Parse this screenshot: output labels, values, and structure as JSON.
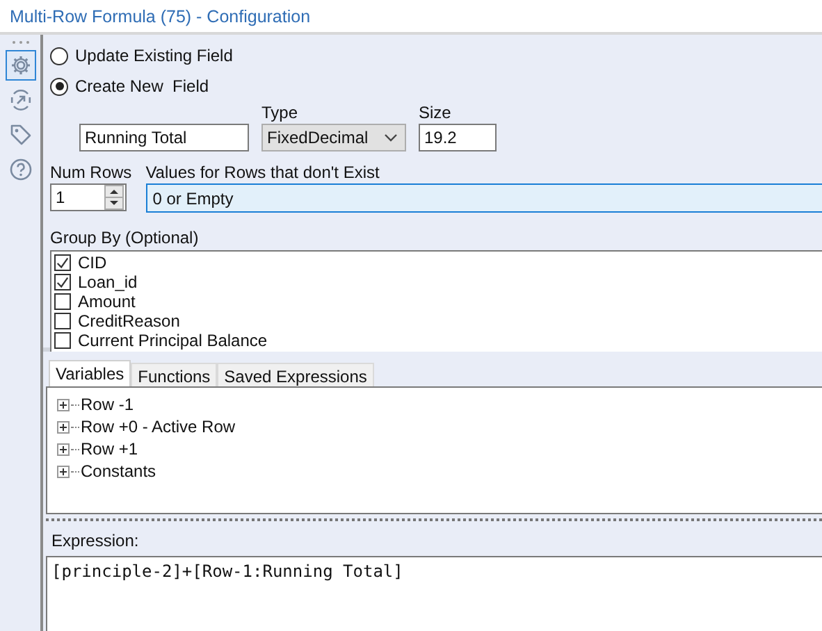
{
  "window": {
    "title": "Multi-Row Formula (75) - Configuration"
  },
  "sidebar": {
    "items": [
      {
        "kind": "gear",
        "selected": true
      },
      {
        "kind": "arrow",
        "selected": false
      },
      {
        "kind": "tag",
        "selected": false
      },
      {
        "kind": "help",
        "selected": false
      }
    ]
  },
  "mode_options": [
    {
      "label": "Update Existing Field",
      "selected": false
    },
    {
      "label": "Create New  Field",
      "selected": true
    }
  ],
  "new_field": {
    "name_value": "Running Total",
    "type_label": "Type",
    "type_value": "FixedDecimal",
    "size_label": "Size",
    "size_value": "19.2"
  },
  "num_rows": {
    "label": "Num Rows",
    "value": "1"
  },
  "missing_values": {
    "label": "Values for Rows that don't Exist",
    "value": "0 or Empty"
  },
  "group_by": {
    "label": "Group By (Optional)",
    "items": [
      {
        "label": "CID",
        "checked": true
      },
      {
        "label": "Loan_id",
        "checked": true
      },
      {
        "label": "Amount",
        "checked": false
      },
      {
        "label": "CreditReason",
        "checked": false
      },
      {
        "label": "Current Principal Balance",
        "checked": false
      }
    ]
  },
  "tabs": [
    {
      "label": "Variables",
      "selected": true
    },
    {
      "label": "Functions",
      "selected": false
    },
    {
      "label": "Saved Expressions",
      "selected": false
    }
  ],
  "tree": [
    {
      "label": "Row -1",
      "expanded": false
    },
    {
      "label": "Row +0 - Active Row",
      "expanded": false
    },
    {
      "label": "Row +1",
      "expanded": false
    },
    {
      "label": "Constants",
      "expanded": false
    }
  ],
  "expression": {
    "label": "Expression:",
    "value": "[principle-2]+[Row-1:Running Total]"
  }
}
